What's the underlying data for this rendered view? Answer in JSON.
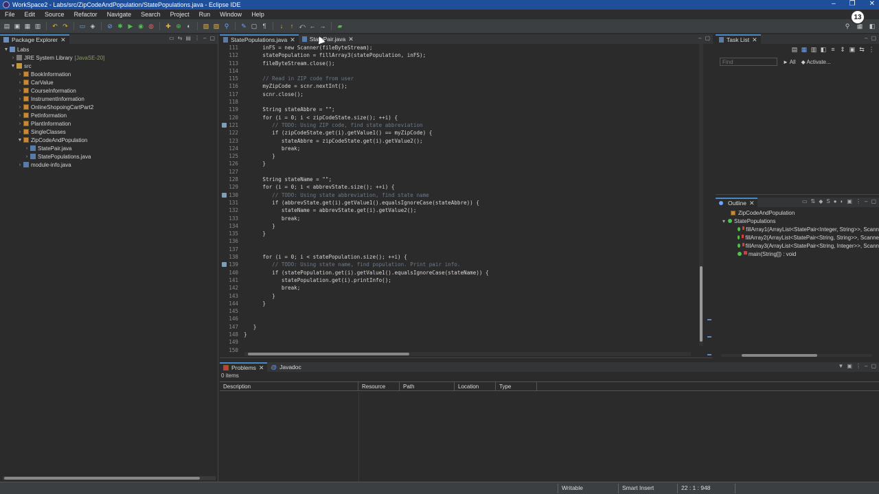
{
  "window": {
    "title": "WorkSpace2 - Labs/src/ZipCodeAndPopulation/StatePopulations.java - Eclipse IDE"
  },
  "menu": [
    "File",
    "Edit",
    "Source",
    "Refactor",
    "Navigate",
    "Search",
    "Project",
    "Run",
    "Window",
    "Help"
  ],
  "notification_count": "13",
  "package_explorer": {
    "tab_label": "Package Explorer",
    "tree": [
      {
        "label": "Labs",
        "depth": 0,
        "arrow": "▼",
        "icon": "proj"
      },
      {
        "label": "JRE System Library",
        "extra": "[JavaSE-20]",
        "depth": 1,
        "arrow": "›",
        "icon": "lib"
      },
      {
        "label": "src",
        "depth": 1,
        "arrow": "▼",
        "icon": "src"
      },
      {
        "label": "BookInformation",
        "depth": 2,
        "arrow": "›",
        "icon": "pkgi"
      },
      {
        "label": "CarValue",
        "depth": 2,
        "arrow": "›",
        "icon": "pkgi"
      },
      {
        "label": "CourseInformation",
        "depth": 2,
        "arrow": "›",
        "icon": "pkgi"
      },
      {
        "label": "InstrumentInformation",
        "depth": 2,
        "arrow": "›",
        "icon": "pkgi"
      },
      {
        "label": "OnlineShopoingCartPart2",
        "depth": 2,
        "arrow": "›",
        "icon": "pkgi"
      },
      {
        "label": "PetInformation",
        "depth": 2,
        "arrow": "›",
        "icon": "pkgi"
      },
      {
        "label": "PlantInformation",
        "depth": 2,
        "arrow": "›",
        "icon": "pkgi"
      },
      {
        "label": "SingleClasses",
        "depth": 2,
        "arrow": "›",
        "icon": "pkgi"
      },
      {
        "label": "ZipCodeAndPopulation",
        "depth": 2,
        "arrow": "▼",
        "icon": "pkgi"
      },
      {
        "label": "StatePair.java",
        "depth": 3,
        "arrow": "›",
        "icon": "java"
      },
      {
        "label": "StatePopulations.java",
        "depth": 3,
        "arrow": "›",
        "icon": "java"
      },
      {
        "label": "module-info.java",
        "depth": 2,
        "arrow": "›",
        "icon": "java"
      }
    ]
  },
  "editor": {
    "tabs": [
      {
        "label": "StatePopulations.java",
        "active": true
      },
      {
        "label": "StatePair.java",
        "active": false
      }
    ],
    "lines": [
      {
        "n": "111",
        "t": "      inFS = new Scanner(fileByteStream);",
        "type": "code"
      },
      {
        "n": "112",
        "t": "      statePopulation = fillArray3(statePopulation, inFS);",
        "type": "code"
      },
      {
        "n": "113",
        "t": "      fileByteStream.close();",
        "type": "code"
      },
      {
        "n": "114",
        "t": "",
        "type": "code"
      },
      {
        "n": "115",
        "t": "      // Read in ZIP code from user",
        "type": "comment"
      },
      {
        "n": "116",
        "t": "      myZipCode = scnr.nextInt();",
        "type": "code"
      },
      {
        "n": "117",
        "t": "      scnr.close();",
        "type": "code"
      },
      {
        "n": "118",
        "t": "",
        "type": "code"
      },
      {
        "n": "119",
        "t": "      String stateAbbre = \"\";",
        "type": "code"
      },
      {
        "n": "120",
        "t": "      for (i = 0; i < zipCodeState.size(); ++i) {",
        "type": "code"
      },
      {
        "n": "121",
        "t": "         // TODO: Using ZIP code, find state abbreviation",
        "type": "comment",
        "marker": true
      },
      {
        "n": "122",
        "t": "         if (zipCodeState.get(i).getValue1() == myZipCode) {",
        "type": "code"
      },
      {
        "n": "123",
        "t": "            stateAbbre = zipCodeState.get(i).getValue2();",
        "type": "code"
      },
      {
        "n": "124",
        "t": "            break;",
        "type": "code"
      },
      {
        "n": "125",
        "t": "         }",
        "type": "code"
      },
      {
        "n": "126",
        "t": "      }",
        "type": "code"
      },
      {
        "n": "127",
        "t": "",
        "type": "code"
      },
      {
        "n": "128",
        "t": "      String stateName = \"\";",
        "type": "code"
      },
      {
        "n": "129",
        "t": "      for (i = 0; i < abbrevState.size(); ++i) {",
        "type": "code"
      },
      {
        "n": "130",
        "t": "         // TODO: Using state abbreviation, find state name",
        "type": "comment",
        "marker": true
      },
      {
        "n": "131",
        "t": "         if (abbrevState.get(i).getValue1().equalsIgnoreCase(stateAbbre)) {",
        "type": "code"
      },
      {
        "n": "132",
        "t": "            stateName = abbrevState.get(i).getValue2();",
        "type": "code"
      },
      {
        "n": "133",
        "t": "            break;",
        "type": "code"
      },
      {
        "n": "134",
        "t": "         }",
        "type": "code"
      },
      {
        "n": "135",
        "t": "      }",
        "type": "code"
      },
      {
        "n": "136",
        "t": "",
        "type": "code"
      },
      {
        "n": "137",
        "t": "",
        "type": "code"
      },
      {
        "n": "138",
        "t": "      for (i = 0; i < statePopulation.size(); ++i) {",
        "type": "code"
      },
      {
        "n": "139",
        "t": "         // TODO: Using state name, find population. Print pair info.",
        "type": "comment",
        "marker": true
      },
      {
        "n": "140",
        "t": "         if (statePopulation.get(i).getValue1().equalsIgnoreCase(stateName)) {",
        "type": "code"
      },
      {
        "n": "141",
        "t": "            statePopulation.get(i).printInfo();",
        "type": "code"
      },
      {
        "n": "142",
        "t": "            break;",
        "type": "code"
      },
      {
        "n": "143",
        "t": "         }",
        "type": "code"
      },
      {
        "n": "144",
        "t": "      }",
        "type": "code"
      },
      {
        "n": "145",
        "t": "",
        "type": "code"
      },
      {
        "n": "146",
        "t": "",
        "type": "code"
      },
      {
        "n": "147",
        "t": "   }",
        "type": "code"
      },
      {
        "n": "148",
        "t": "}",
        "type": "code"
      },
      {
        "n": "149",
        "t": "",
        "type": "code"
      },
      {
        "n": "150",
        "t": "",
        "type": "code"
      }
    ]
  },
  "task_list": {
    "tab_label": "Task List",
    "find_placeholder": "Find",
    "all_label": "All",
    "activate_label": "Activate..."
  },
  "outline": {
    "tab_label": "Outline",
    "items": [
      {
        "label": "ZipCodeAndPopulation",
        "depth": 0,
        "kind": "package"
      },
      {
        "label": "StatePopulations",
        "depth": 0,
        "kind": "class"
      },
      {
        "label": "fillArray1(ArrayList<StatePair<Integer, String>>, Scann",
        "depth": 1,
        "kind": "method"
      },
      {
        "label": "fillArray2(ArrayList<StatePair<String, String>>, Scanne",
        "depth": 1,
        "kind": "method"
      },
      {
        "label": "fillArray3(ArrayList<StatePair<String, Integer>>, Scann",
        "depth": 1,
        "kind": "method"
      },
      {
        "label": "main(String[]) : void",
        "depth": 1,
        "kind": "method"
      }
    ]
  },
  "bottom": {
    "tabs": [
      {
        "label": "Problems",
        "active": true
      },
      {
        "label": "Javadoc",
        "active": false
      }
    ],
    "items_count": "0 items",
    "columns": [
      "Description",
      "Resource",
      "Path",
      "Location",
      "Type"
    ]
  },
  "status": {
    "writable": "Writable",
    "insert_mode": "Smart Insert",
    "position": "22 : 1 : 948"
  },
  "colors": {
    "titlebar": "#1f4e9a",
    "keyword": "#cc7832",
    "comment": "#6d7a8a",
    "string": "#6a8759"
  }
}
